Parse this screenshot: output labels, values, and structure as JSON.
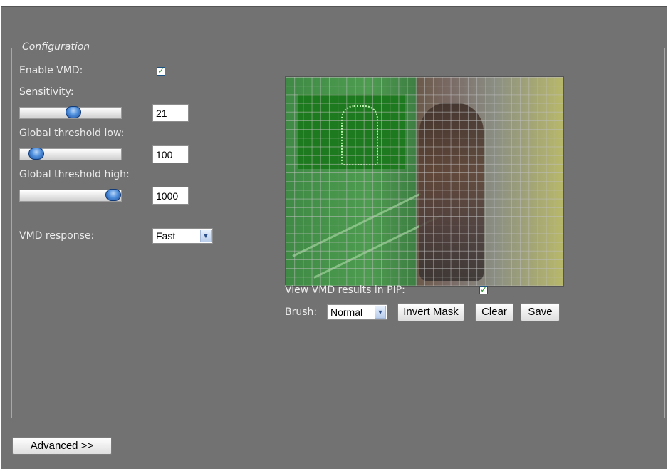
{
  "config": {
    "legend": "Configuration",
    "enable_vmd": {
      "label": "Enable VMD:",
      "checked": true
    },
    "sensitivity": {
      "label": "Sensitivity:",
      "value": "21",
      "slider_level": 0.5
    },
    "threshold_low": {
      "label": "Global threshold low:",
      "value": "100",
      "slider_level": 0.15
    },
    "threshold_high": {
      "label": "Global threshold high:",
      "value": "1000",
      "slider_level": 0.92
    },
    "vmd_response": {
      "label": "VMD response:",
      "selected": "Fast"
    }
  },
  "video": {
    "pip": {
      "label": "View VMD results in PIP:",
      "checked": true
    },
    "brush": {
      "label": "Brush:",
      "selected": "Normal"
    },
    "buttons": {
      "invert_mask": "Invert Mask",
      "clear": "Clear",
      "save": "Save"
    }
  },
  "footer": {
    "advanced_label": "Advanced >>"
  },
  "icons": {
    "checkbox_tick": "check-icon",
    "dropdown_arrow": "chevron-down-icon"
  },
  "colors": {
    "panel": "#727272",
    "mask_green": "#1e7a1e",
    "slider_thumb": "#4f8fdc"
  }
}
